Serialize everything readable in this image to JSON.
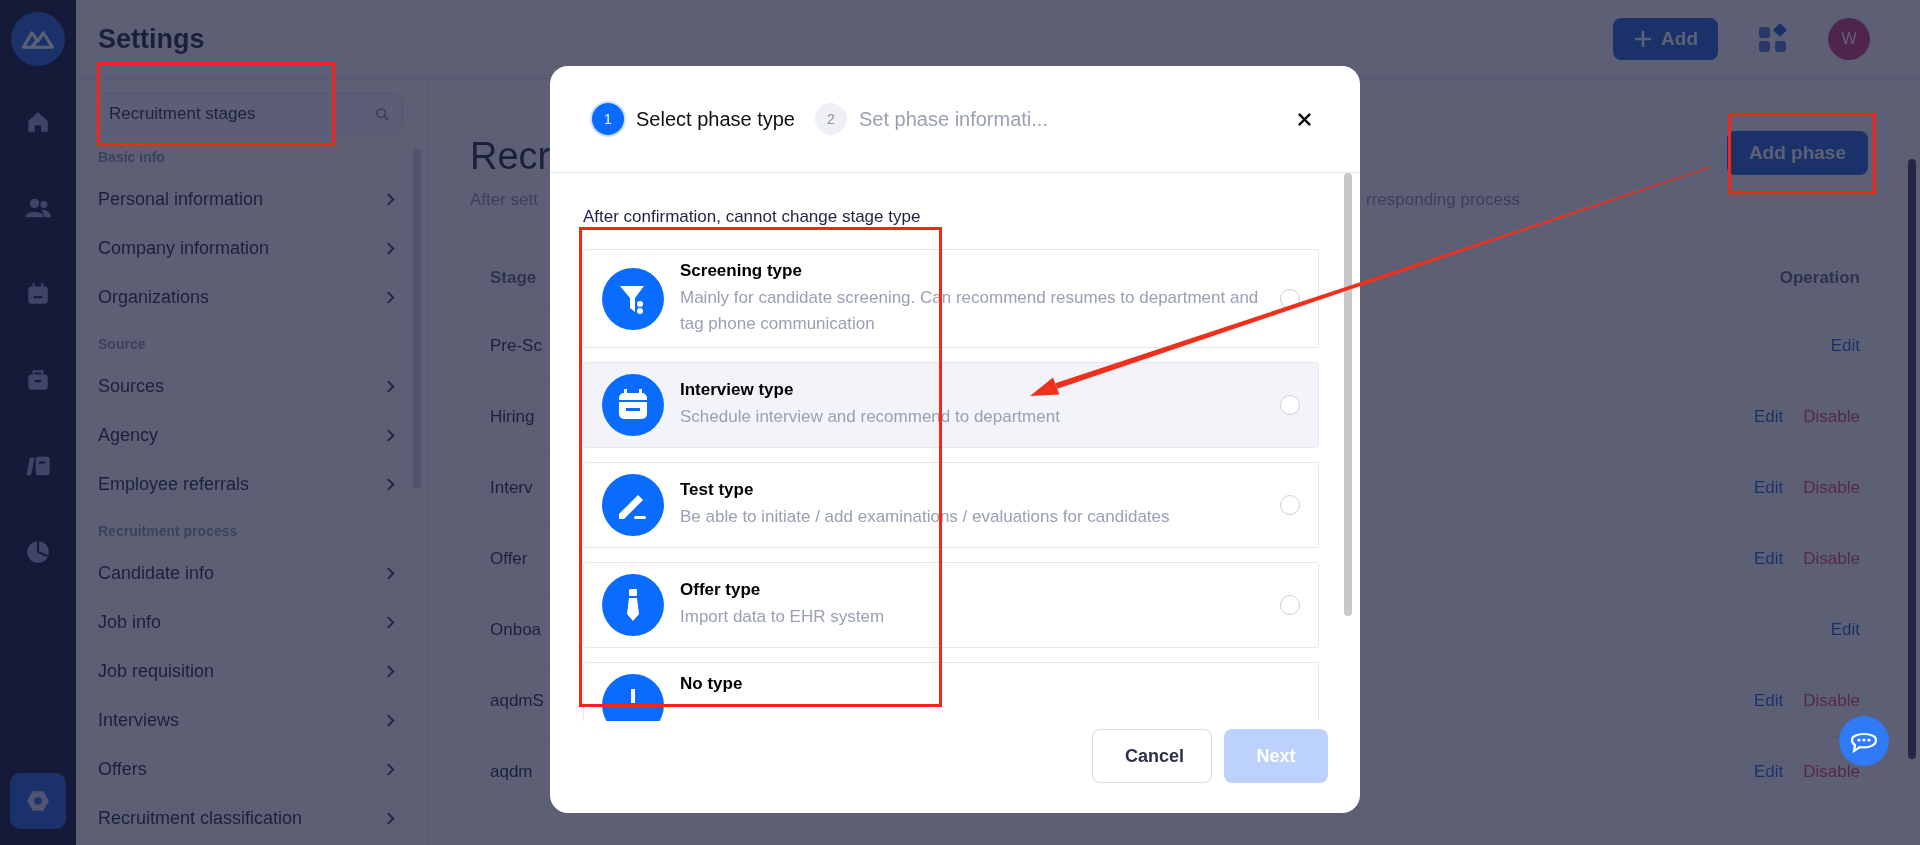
{
  "nav_items": [
    {
      "kind": "home",
      "selected": false
    },
    {
      "kind": "people",
      "selected": false
    },
    {
      "kind": "calendar",
      "selected": false
    },
    {
      "kind": "briefcase",
      "selected": false
    },
    {
      "kind": "book",
      "selected": false
    },
    {
      "kind": "chart",
      "selected": false
    },
    {
      "kind": "settings",
      "selected": true
    }
  ],
  "header": {
    "title": "Settings",
    "add_button": "Add",
    "avatar": "W"
  },
  "settings_sidebar": {
    "search": {
      "value": "Recruitment stages"
    },
    "sections": [
      {
        "heading": "Basic info",
        "items": [
          "Personal information",
          "Company information",
          "Organizations"
        ]
      },
      {
        "heading": "Source",
        "items": [
          "Sources",
          "Agency",
          "Employee referrals"
        ]
      },
      {
        "heading": "Recruitment process",
        "items": [
          "Candidate info",
          "Job info",
          "Job requisition",
          "Interviews",
          "Offers",
          "Recruitment classification"
        ]
      }
    ]
  },
  "main": {
    "heading": "Recr",
    "subtitle_left": "After sett",
    "subtitle_right": "rresponding process",
    "add_phase_button": "Add phase",
    "table": {
      "columns": [
        "Stage",
        "Operation"
      ],
      "rows": [
        {
          "name": "Pre-Sc",
          "actions": [
            {
              "label": "Edit",
              "kind": "edit"
            }
          ]
        },
        {
          "name": "Hiring",
          "actions": [
            {
              "label": "Edit",
              "kind": "edit"
            },
            {
              "label": "Disable",
              "kind": "disable"
            }
          ]
        },
        {
          "name": "Interv",
          "actions": [
            {
              "label": "Edit",
              "kind": "edit"
            },
            {
              "label": "Disable",
              "kind": "disable"
            }
          ]
        },
        {
          "name": "Offer",
          "actions": [
            {
              "label": "Edit",
              "kind": "edit"
            },
            {
              "label": "Disable",
              "kind": "disable"
            }
          ]
        },
        {
          "name": "Onboa",
          "actions": [
            {
              "label": "Edit",
              "kind": "edit"
            }
          ]
        },
        {
          "name": "aqdmS",
          "actions": [
            {
              "label": "Edit",
              "kind": "edit"
            },
            {
              "label": "Disable",
              "kind": "disable"
            }
          ]
        },
        {
          "name": "aqdm",
          "actions": [
            {
              "label": "Edit",
              "kind": "edit"
            },
            {
              "label": "Disable",
              "kind": "disable"
            }
          ]
        }
      ]
    }
  },
  "modal": {
    "steps": [
      {
        "number": "1",
        "label": "Select phase type",
        "selected": true
      },
      {
        "number": "2",
        "label": "Set phase informati...",
        "selected": false
      }
    ],
    "hint": "After confirmation, cannot change stage type",
    "options": [
      {
        "kind": "screening",
        "title": "Screening type",
        "description": "Mainly for candidate screening. Can recommend resumes to department and tag phone communication",
        "selected": false,
        "hovered": false
      },
      {
        "kind": "interview",
        "title": "Interview type",
        "description": "Schedule interview and recommend to department",
        "selected": false,
        "hovered": true
      },
      {
        "kind": "test",
        "title": "Test type",
        "description": "Be able to initiate / add examinations / evaluations for candidates",
        "selected": false,
        "hovered": false
      },
      {
        "kind": "offer",
        "title": "Offer type",
        "description": "Import data to EHR system",
        "selected": false,
        "hovered": false
      },
      {
        "kind": "none",
        "title": "No type",
        "hovered": false
      }
    ],
    "buttons": [
      {
        "label": "Cancel",
        "kind": "secondary",
        "disabled": false
      },
      {
        "label": "Next",
        "kind": "primary",
        "disabled": true
      }
    ]
  }
}
